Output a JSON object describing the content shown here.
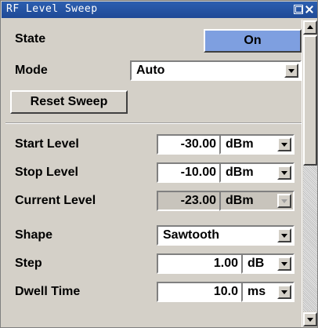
{
  "window": {
    "title": "RF Level Sweep"
  },
  "state": {
    "label": "State",
    "value": "On"
  },
  "mode": {
    "label": "Mode",
    "value": "Auto"
  },
  "reset": {
    "label": "Reset Sweep"
  },
  "start_level": {
    "label": "Start Level",
    "value": "-30.00",
    "unit": "dBm"
  },
  "stop_level": {
    "label": "Stop Level",
    "value": "-10.00",
    "unit": "dBm"
  },
  "current_level": {
    "label": "Current Level",
    "value": "-23.00",
    "unit": "dBm"
  },
  "shape": {
    "label": "Shape",
    "value": "Sawtooth"
  },
  "step": {
    "label": "Step",
    "value": "1.00",
    "unit": "dB"
  },
  "dwell_time": {
    "label": "Dwell Time",
    "value": "10.0",
    "unit": "ms"
  },
  "colors": {
    "title_bar": "#1f4a96",
    "state_on": "#7e9fe0",
    "panel_bg": "#d4d0c8",
    "disabled_bg": "#c8c4bc"
  },
  "icons": {
    "title_buttons": [
      "restore-icon",
      "close-icon"
    ],
    "dropdown": "chevron-down-icon",
    "scroll": [
      "scroll-up-icon",
      "scroll-down-icon"
    ]
  }
}
